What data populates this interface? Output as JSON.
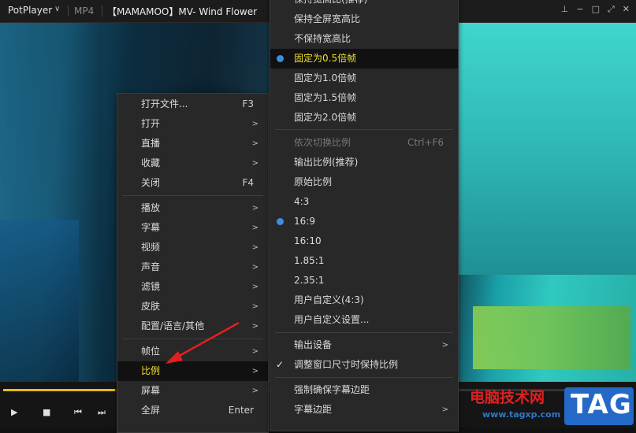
{
  "titlebar": {
    "app": "PotPlayer",
    "caret": "∨",
    "format": "MP4",
    "title": "【MAMAMOO】MV- Wind Flower",
    "buttons": [
      "⊥",
      "−",
      "□",
      "⤢",
      "✕"
    ]
  },
  "controls": [
    "▶",
    "■",
    "⏮",
    "⏭"
  ],
  "left_menu": {
    "items": [
      {
        "label": "打开文件...",
        "shortcut": "F3"
      },
      {
        "label": "打开",
        "arrow": ">"
      },
      {
        "label": "直播",
        "arrow": ">"
      },
      {
        "label": "收藏",
        "arrow": ">"
      },
      {
        "label": "关闭",
        "shortcut": "F4"
      },
      {
        "label": "播放",
        "arrow": ">"
      },
      {
        "label": "字幕",
        "arrow": ">"
      },
      {
        "label": "视频",
        "arrow": ">"
      },
      {
        "label": "声音",
        "arrow": ">"
      },
      {
        "label": "滤镜",
        "arrow": ">"
      },
      {
        "label": "皮肤",
        "arrow": ">"
      },
      {
        "label": "配置/语言/其他",
        "arrow": ">"
      },
      {
        "label": "帧位",
        "arrow": ">"
      },
      {
        "label": "比例",
        "arrow": ">"
      },
      {
        "label": "屏幕",
        "arrow": ">"
      },
      {
        "label": "全屏",
        "shortcut": "Enter"
      }
    ]
  },
  "right_menu": {
    "items": [
      {
        "label": "保持宽高比(推荐)"
      },
      {
        "label": "保持全屏宽高比"
      },
      {
        "label": "不保持宽高比"
      },
      {
        "label": "固定为0.5倍帧"
      },
      {
        "label": "固定为1.0倍帧"
      },
      {
        "label": "固定为1.5倍帧"
      },
      {
        "label": "固定为2.0倍帧"
      },
      {
        "label": "依次切换比例",
        "shortcut": "Ctrl+F6"
      },
      {
        "label": "输出比例(推荐)"
      },
      {
        "label": "原始比例"
      },
      {
        "label": "4:3"
      },
      {
        "label": "16:9"
      },
      {
        "label": "16:10"
      },
      {
        "label": "1.85:1"
      },
      {
        "label": "2.35:1"
      },
      {
        "label": "用户自定义(4:3)"
      },
      {
        "label": "用户自定义设置..."
      },
      {
        "label": "输出设备",
        "arrow": ">"
      },
      {
        "label": "调整窗口尺寸时保持比例",
        "check": "✓"
      },
      {
        "label": "强制确保字幕边距"
      },
      {
        "label": "字幕边距",
        "arrow": ">"
      }
    ]
  },
  "watermark": {
    "line1": "电脑技术网",
    "line2": "www.tagxp.com",
    "logo": "TAG"
  },
  "colors": {
    "highlight_text": "#f2e02a",
    "radio": "#3c8fe0",
    "seek": "#e0c01a",
    "arrow": "#e02020"
  }
}
